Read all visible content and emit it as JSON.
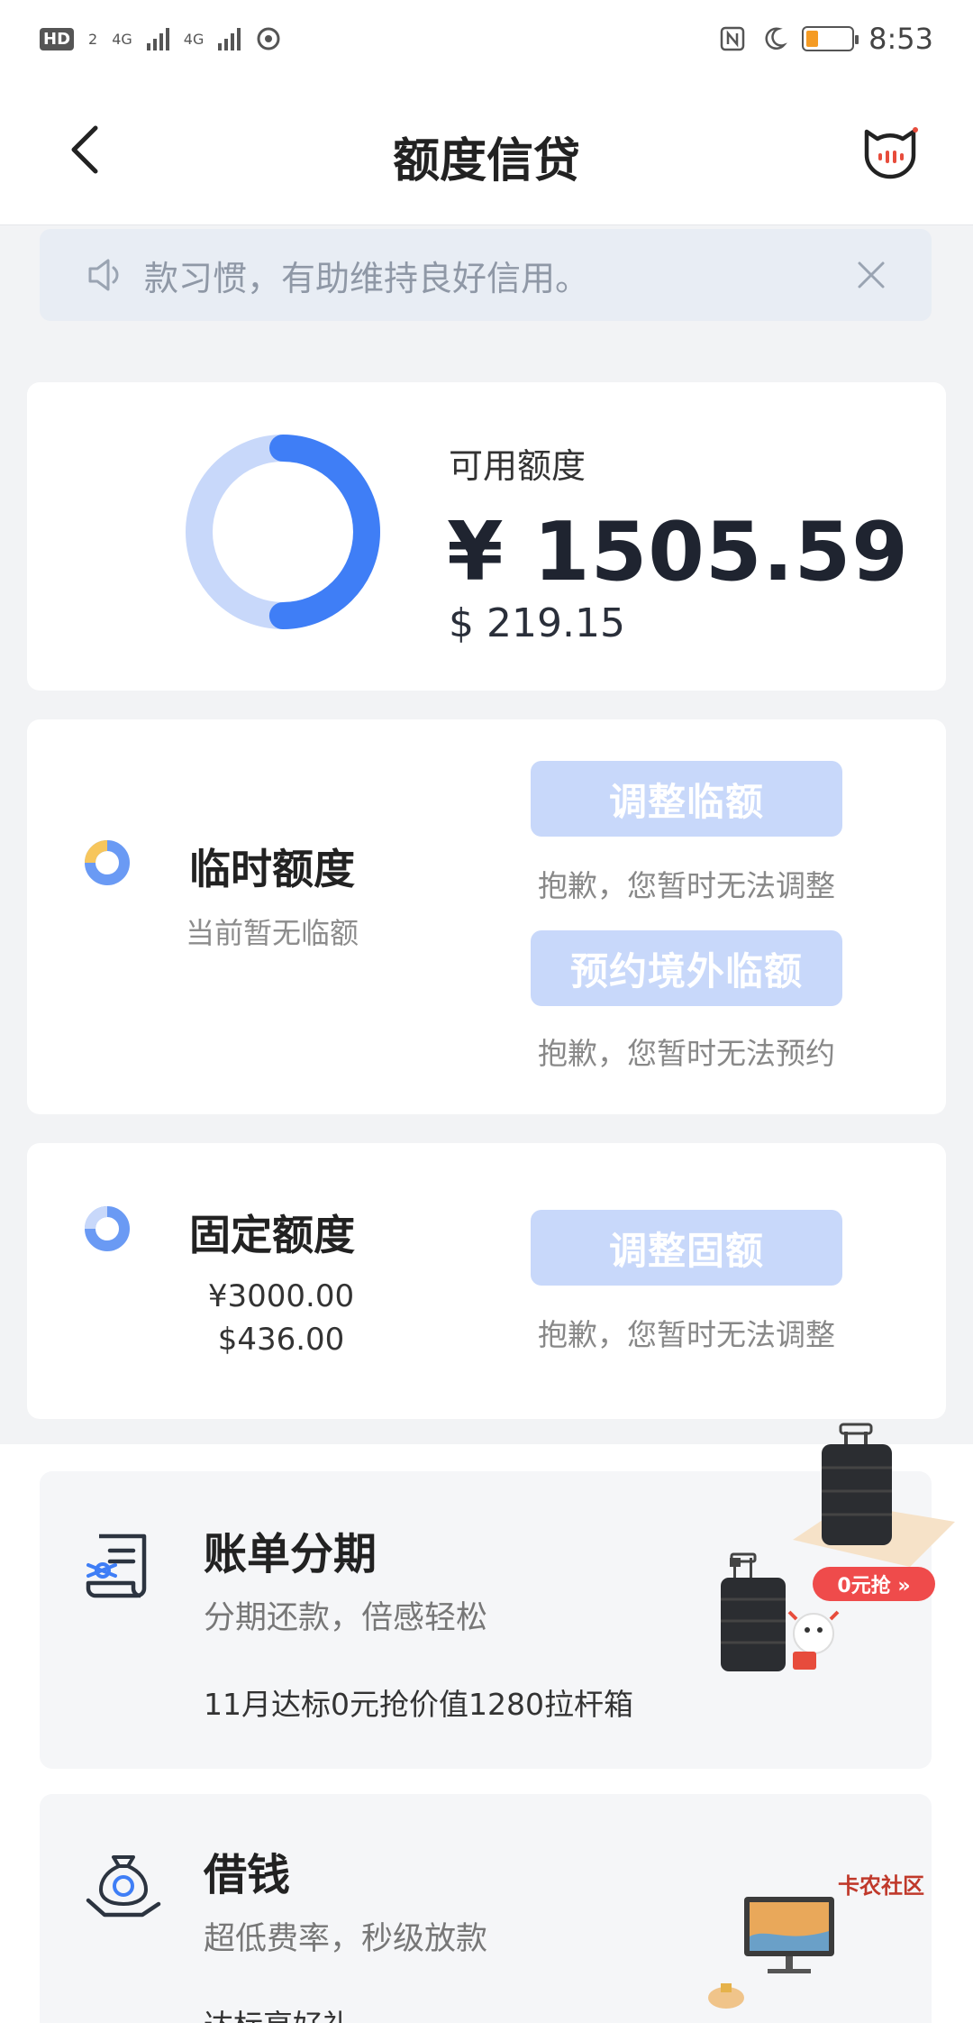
{
  "status_bar": {
    "hd_label": "HD",
    "hd_sub": "2",
    "net1": "4G",
    "net2": "4G",
    "time": "8:53"
  },
  "nav": {
    "title": "额度信贷"
  },
  "notice": {
    "text": "款习惯，有助维持良好信用。"
  },
  "available": {
    "label": "可用额度",
    "cny": "¥ 1505.59",
    "usd": "$ 219.15",
    "ring_used_fraction": 0.5,
    "ring_color": "#3f7ef6",
    "ring_track_color": "#c8d8fa"
  },
  "temp_credit": {
    "title": "临时额度",
    "subtitle": "当前暂无临额",
    "adjust_button": "调整临额",
    "adjust_note": "抱歉，您暂时无法调整",
    "reserve_button": "预约境外临额",
    "reserve_note": "抱歉，您暂时无法预约"
  },
  "fixed_credit": {
    "title": "固定额度",
    "amount_cny": "¥3000.00",
    "amount_usd": "$436.00",
    "adjust_button": "调整固额",
    "adjust_note": "抱歉，您暂时无法调整"
  },
  "promos": [
    {
      "title": "账单分期",
      "subtitle": "分期还款，倍感轻松",
      "tag": "11月达标0元抢价值1280拉杆箱",
      "badge": "0元抢 »"
    },
    {
      "title": "借钱",
      "subtitle": "超低费率，秒级放款",
      "tag": "达标享好礼"
    }
  ],
  "watermark": "卡农社区"
}
